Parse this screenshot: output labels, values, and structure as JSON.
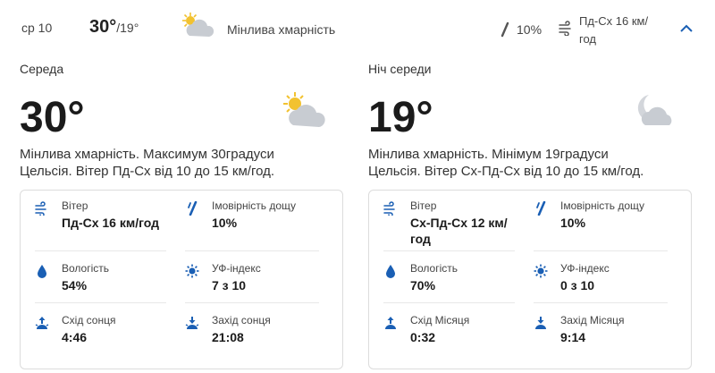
{
  "header": {
    "day": "ср 10",
    "high": "30°",
    "low": "/19°",
    "condition": "Мінлива хмарність",
    "rain": "10%",
    "wind": "Пд-Сх 16 км/год",
    "icon": "partly-cloudy-day-icon"
  },
  "day": {
    "title": "Середа",
    "temp": "30°",
    "description": "Мінлива хмарність. Максимум 30градуси Цельсія. Вітер Пд-Сх від 10 до 15 км/год.",
    "details": {
      "wind_label": "Вітер",
      "wind_value": "Пд-Сх 16 км/год",
      "rain_label": "Імовірність дощу",
      "rain_value": "10%",
      "humidity_label": "Вологість",
      "humidity_value": "54%",
      "uv_label": "УФ-індекс",
      "uv_value": "7 з 10",
      "rise_label": "Схід сонця",
      "rise_value": "4:46",
      "set_label": "Захід сонця",
      "set_value": "21:08"
    }
  },
  "night": {
    "title": "Ніч середи",
    "temp": "19°",
    "description": "Мінлива хмарність. Мінімум 19градуси Цельсія. Вітер Сх-Пд-Сх від 10 до 15 км/год.",
    "details": {
      "wind_label": "Вітер",
      "wind_value": "Сх-Пд-Сх 12 км/год",
      "rain_label": "Імовірність дощу",
      "rain_value": "10%",
      "humidity_label": "Вологість",
      "humidity_value": "70%",
      "uv_label": "УФ-індекс",
      "uv_value": "0 з 10",
      "rise_label": "Схід Місяця",
      "rise_value": "0:32",
      "set_label": "Захід Місяця",
      "set_value": "9:14"
    }
  },
  "colors": {
    "accent": "#1a5fb4",
    "sun": "#f2c230",
    "cloud": "#c8ccd2"
  }
}
